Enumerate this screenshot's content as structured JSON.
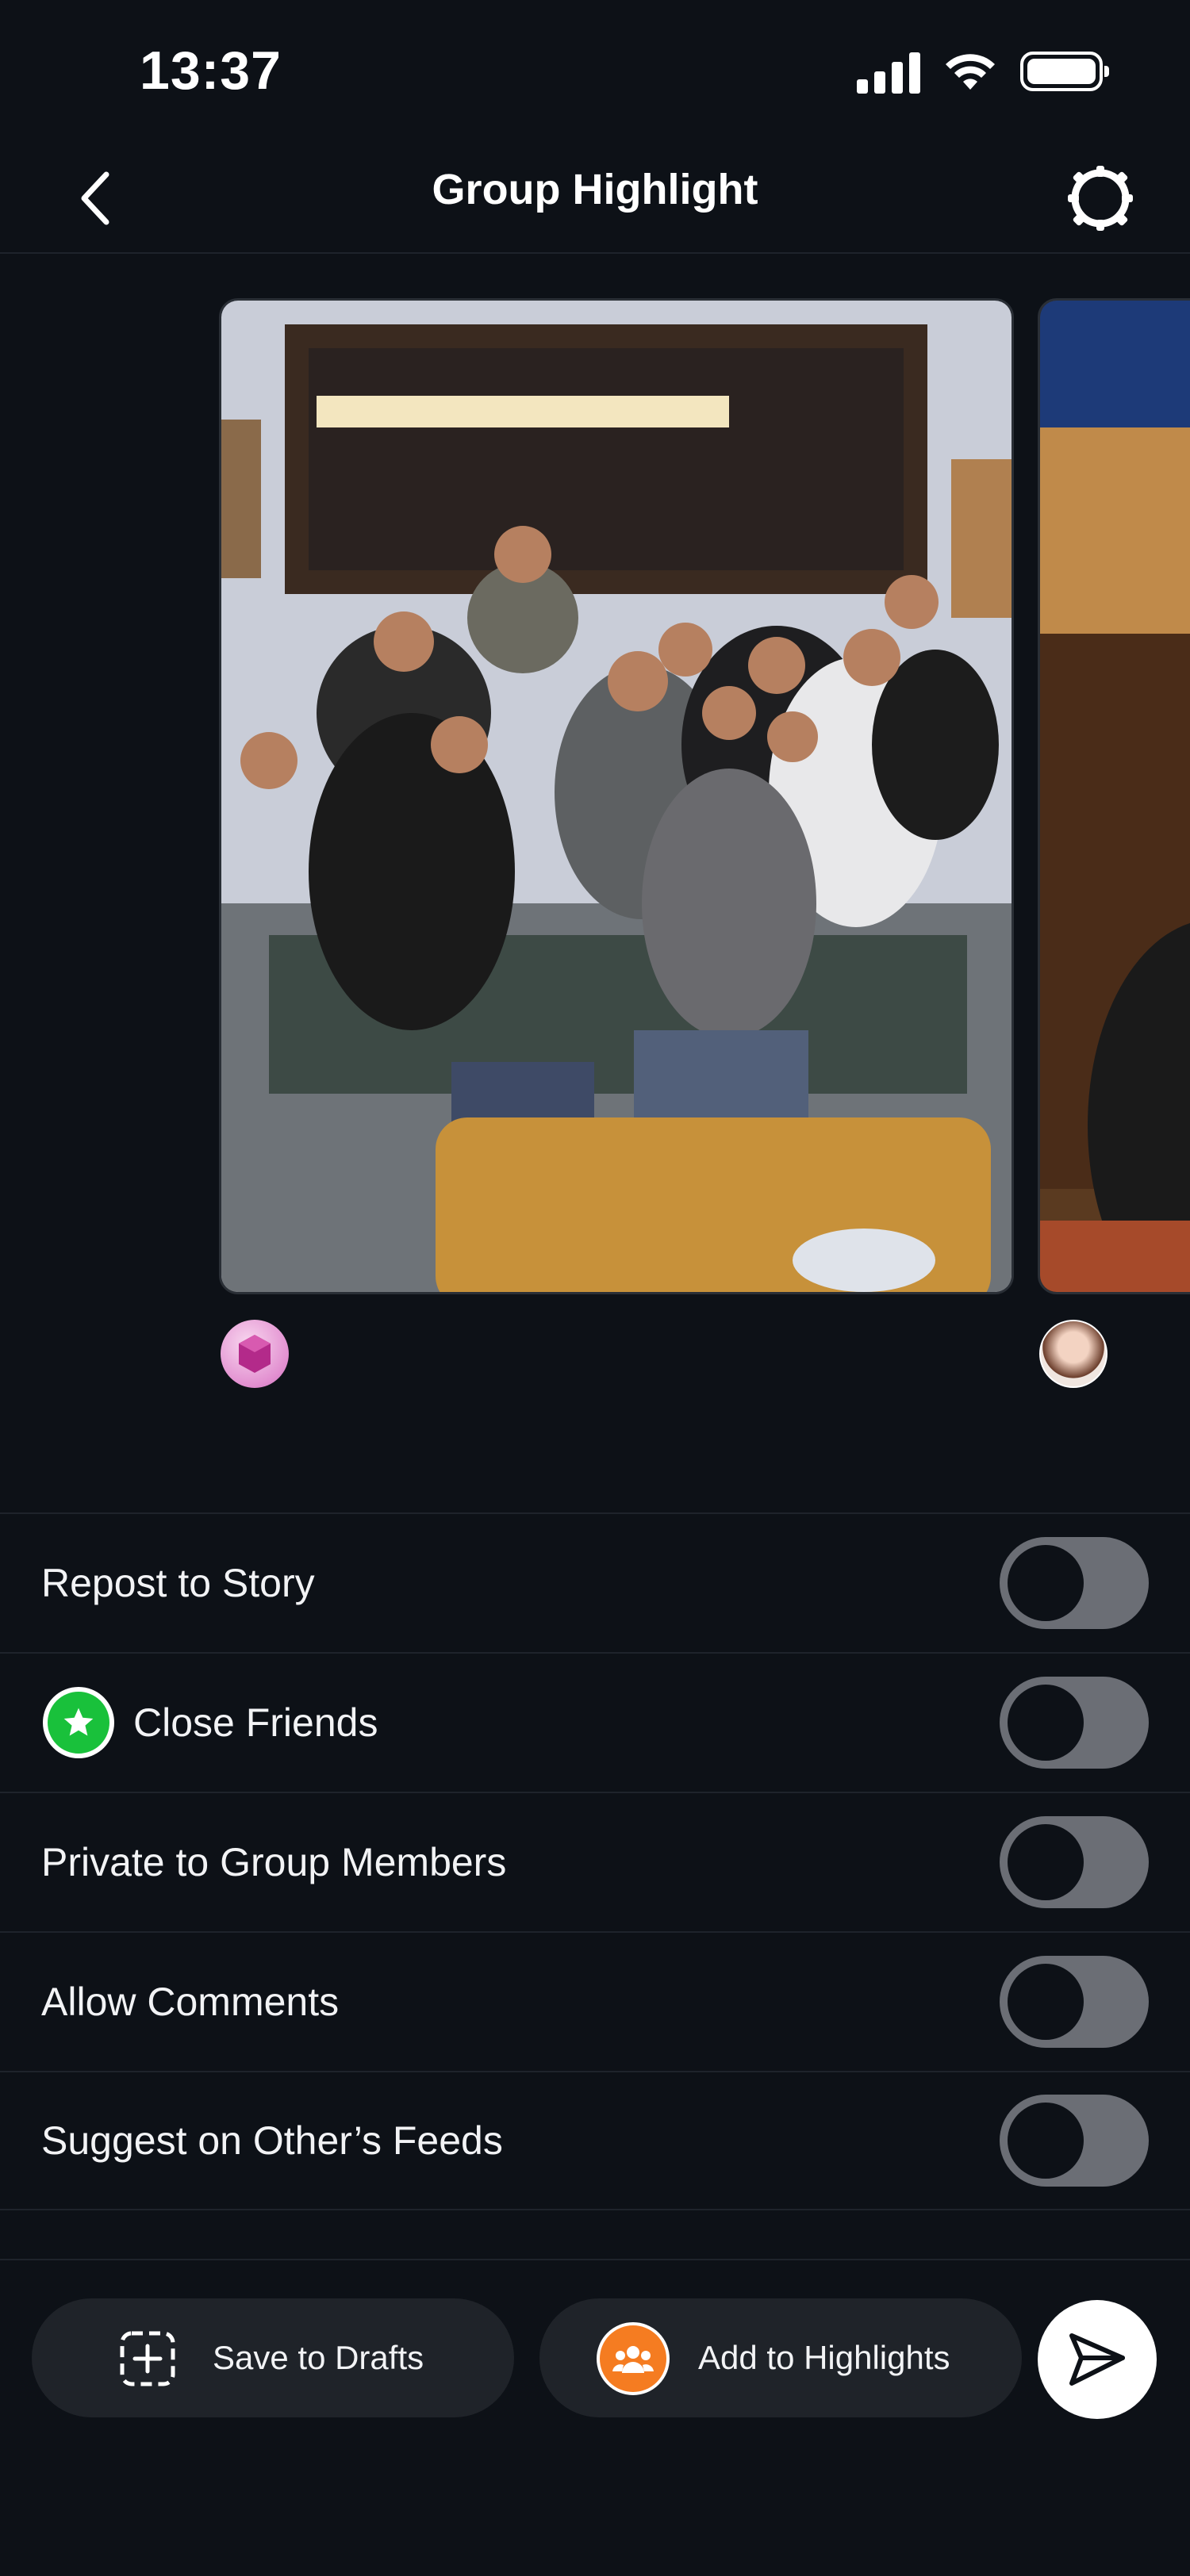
{
  "status_bar": {
    "time": "13:37"
  },
  "header": {
    "title": "Group Highlight"
  },
  "icons": {
    "back": "chevron-left-icon",
    "settings": "gear-icon",
    "close_friends": "star-icon",
    "save_drafts": "add-square-icon",
    "add_highlights": "group-icon",
    "send": "paper-plane-icon"
  },
  "settings": [
    {
      "label": "Repost to Story",
      "on": false
    },
    {
      "label": "Close Friends",
      "on": false
    },
    {
      "label": "Private to Group Members",
      "on": false
    },
    {
      "label": "Allow Comments",
      "on": false
    },
    {
      "label": "Suggest on Other’s Feeds",
      "on": false
    }
  ],
  "actions": {
    "save_drafts": "Save to Drafts",
    "add_highlights": "Add to Highlights"
  },
  "colors": {
    "background": "#0d1117",
    "close_friends_green": "#19c13b",
    "highlights_orange": "#f57c21",
    "toggle_off": "#6b6e75"
  }
}
